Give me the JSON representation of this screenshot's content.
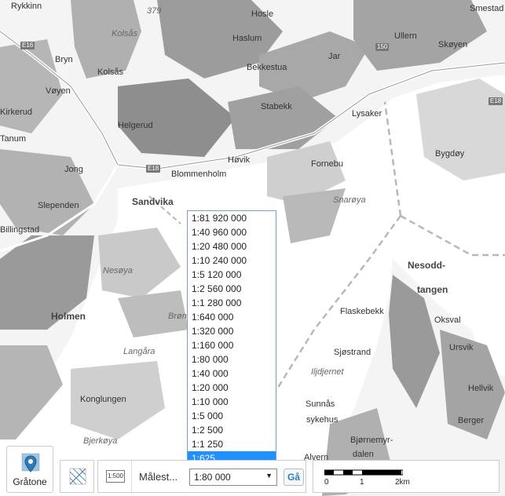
{
  "map": {
    "places": [
      {
        "name": "Rykkinn",
        "style": "normal"
      },
      {
        "name": "379",
        "style": "italic"
      },
      {
        "name": "Hosle",
        "style": "normal"
      },
      {
        "name": "Smestad",
        "style": "normal"
      },
      {
        "name": "Kolsås",
        "style": "italic"
      },
      {
        "name": "Haslum",
        "style": "normal"
      },
      {
        "name": "Ullern",
        "style": "normal"
      },
      {
        "name": "Bryn",
        "style": "normal"
      },
      {
        "name": "Jar",
        "style": "normal"
      },
      {
        "name": "Skøyen",
        "style": "normal"
      },
      {
        "name": "Kolsås",
        "style": "normal"
      },
      {
        "name": "Bekkestua",
        "style": "normal"
      },
      {
        "name": "Vøyen",
        "style": "normal"
      },
      {
        "name": "Kirkerud",
        "style": "normal"
      },
      {
        "name": "Stabekk",
        "style": "normal"
      },
      {
        "name": "Lysaker",
        "style": "normal"
      },
      {
        "name": "Helgerud",
        "style": "normal"
      },
      {
        "name": "Tanum",
        "style": "normal"
      },
      {
        "name": "Bygdøy",
        "style": "normal"
      },
      {
        "name": "Høvik",
        "style": "normal"
      },
      {
        "name": "Jong",
        "style": "normal"
      },
      {
        "name": "Blommenholm",
        "style": "normal"
      },
      {
        "name": "Fornebu",
        "style": "normal"
      },
      {
        "name": "Sandvika",
        "style": "bold"
      },
      {
        "name": "Snarøya",
        "style": "italic"
      },
      {
        "name": "Slependen",
        "style": "normal"
      },
      {
        "name": "Billingstad",
        "style": "normal"
      },
      {
        "name": "Nesodd-",
        "style": "bold"
      },
      {
        "name": "tangen",
        "style": "bold"
      },
      {
        "name": "Nesøya",
        "style": "italic"
      },
      {
        "name": "Holmen",
        "style": "bold"
      },
      {
        "name": "Flaskebekk",
        "style": "normal"
      },
      {
        "name": "Oksval",
        "style": "normal"
      },
      {
        "name": "Brønnøya",
        "style": "italic"
      },
      {
        "name": "Langåra",
        "style": "italic"
      },
      {
        "name": "Sjøstrand",
        "style": "normal"
      },
      {
        "name": "Ursvik",
        "style": "normal"
      },
      {
        "name": "Iljdjernet",
        "style": "italic"
      },
      {
        "name": "Hellvik",
        "style": "normal"
      },
      {
        "name": "Konglungen",
        "style": "normal"
      },
      {
        "name": "Sunnås",
        "style": "normal"
      },
      {
        "name": "sykehus",
        "style": "normal"
      },
      {
        "name": "Berger",
        "style": "normal"
      },
      {
        "name": "Bjerkøya",
        "style": "italic"
      },
      {
        "name": "Bjørnemyr-",
        "style": "normal"
      },
      {
        "name": "dalen",
        "style": "normal"
      },
      {
        "name": "Alvern",
        "style": "normal"
      }
    ],
    "road_badges": [
      "E16",
      "150",
      "E18",
      "E18"
    ]
  },
  "scale_dropdown": {
    "options": [
      "1:81 920 000",
      "1:40 960 000",
      "1:20 480 000",
      "1:10 240 000",
      "1:5 120 000",
      "1:2 560 000",
      "1:1 280 000",
      "1:640 000",
      "1:320 000",
      "1:160 000",
      "1:80 000",
      "1:40 000",
      "1:20 000",
      "1:10 000",
      "1:5 000",
      "1:2 500",
      "1:1 250",
      "1:625"
    ],
    "highlighted": "1:625"
  },
  "toolbar": {
    "layer_label": "Gråtone",
    "measure_label": "Målest...",
    "scale_value": "1:80 000",
    "go_label": "Gå",
    "scale_icon_text": "1:500",
    "scalebar_labels": [
      "0",
      "1",
      "2km"
    ]
  },
  "colors": {
    "land": "#f4f4f4",
    "forest": "#b0b0b0",
    "forest_dark": "#8e8e8e",
    "water": "#ffffff",
    "accent": "#1e90ff"
  }
}
